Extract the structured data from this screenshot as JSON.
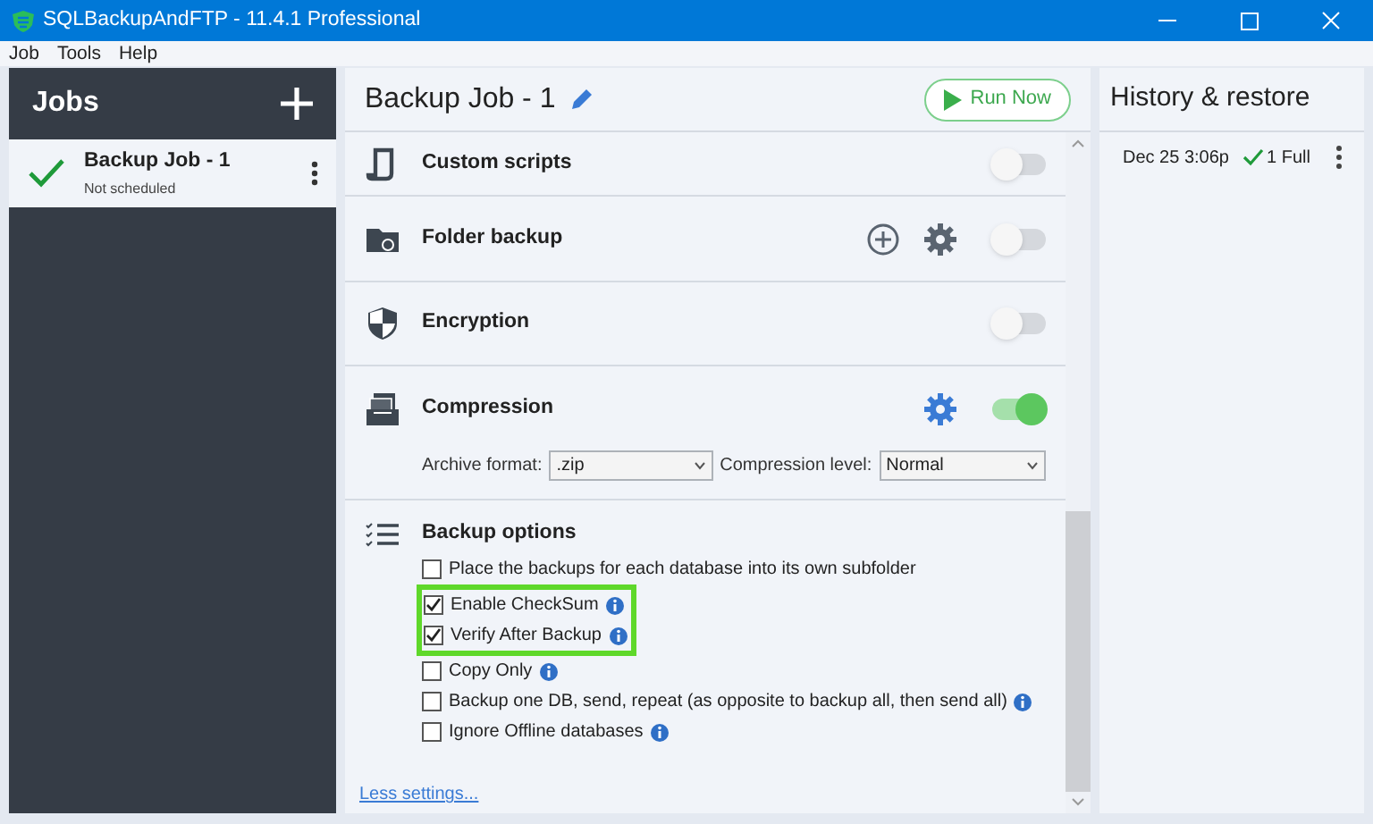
{
  "window": {
    "title": "SQLBackupAndFTP - 11.4.1 Professional"
  },
  "menu": [
    "Job",
    "Tools",
    "Help"
  ],
  "jobs_panel": {
    "title": "Jobs",
    "jobs": [
      {
        "name": "Backup Job - 1",
        "schedule": "Not scheduled",
        "selected": true
      }
    ]
  },
  "job": {
    "title": "Backup Job - 1",
    "run_button": "Run Now",
    "sections": [
      {
        "title": "Custom scripts",
        "on": false,
        "add": false,
        "settings": false
      },
      {
        "title": "Folder backup",
        "on": false,
        "add": true,
        "settings": true
      },
      {
        "title": "Encryption",
        "on": false,
        "add": false,
        "settings": false
      },
      {
        "title": "Compression",
        "on": true,
        "add": false,
        "settings": true,
        "fields": [
          {
            "label": "Archive format:",
            "value": ".zip"
          },
          {
            "label": "Compression level:",
            "value": "Normal"
          }
        ]
      }
    ],
    "backup_options": {
      "title": "Backup options",
      "options": [
        {
          "label": "Place the backups for each database into its own subfolder",
          "checked": false,
          "info": false,
          "highlighted": false
        },
        {
          "label": "Enable CheckSum",
          "checked": true,
          "info": true,
          "highlighted": true
        },
        {
          "label": "Verify After Backup",
          "checked": true,
          "info": true,
          "highlighted": true
        },
        {
          "label": "Copy Only",
          "checked": false,
          "info": true,
          "highlighted": false
        },
        {
          "label": "Backup one DB, send, repeat (as opposite to backup all, then send all)",
          "checked": false,
          "info": true,
          "highlighted": false
        },
        {
          "label": "Ignore Offline databases",
          "checked": false,
          "info": true,
          "highlighted": false
        }
      ]
    },
    "less_link": "Less settings..."
  },
  "history": {
    "title": "History & restore",
    "entries": [
      {
        "time": "Dec 25 3:06p",
        "result": "1 Full"
      }
    ]
  }
}
